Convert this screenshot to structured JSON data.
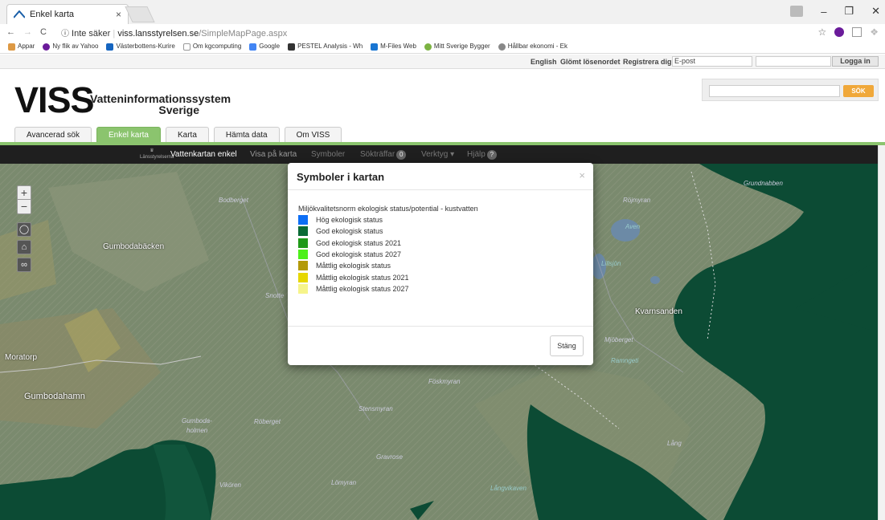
{
  "browser": {
    "tab_title": "Enkel karta",
    "tab_close": "×",
    "url_security": "Inte säker",
    "url_host": "viss.lansstyrelsen.se",
    "url_path": "/SimpleMapPage.aspx",
    "window_controls": [
      "–",
      "❐",
      "✕"
    ]
  },
  "bookmarks": [
    {
      "label": "Appar",
      "color": "#d94"
    },
    {
      "label": "Ny flik av Yahoo",
      "color": "#6a1b9a"
    },
    {
      "label": "Västerbottens-Kurire",
      "color": "#1565c0"
    },
    {
      "label": "Om kgcomputing",
      "color": "#aaa"
    },
    {
      "label": "Google",
      "color": "#4285f4"
    },
    {
      "label": "PESTEL Analysis - Wh",
      "color": "#333"
    },
    {
      "label": "M-Files Web",
      "color": "#1976d2"
    },
    {
      "label": "Mitt Sverige Bygger",
      "color": "#7cb342"
    },
    {
      "label": "Hållbar ekonomi - Ek",
      "color": "#888"
    }
  ],
  "topbar": {
    "english": "English",
    "forgot": "Glömt lösenordet",
    "register": "Registrera dig",
    "email_label": "E-post",
    "login": "Logga in"
  },
  "header": {
    "logo": "VISS",
    "subtitle_1": "Vatteninformationssystem",
    "subtitle_2": "Sverige",
    "search_button": "SÖK"
  },
  "nav_tabs": [
    {
      "label": "Avancerad sök",
      "active": false
    },
    {
      "label": "Enkel karta",
      "active": true
    },
    {
      "label": "Karta",
      "active": false
    },
    {
      "label": "Hämta data",
      "active": false
    },
    {
      "label": "Om VISS",
      "active": false
    }
  ],
  "map_toolbar": {
    "emblem": "Länsstyrelserna",
    "title": "Vattenkartan enkel",
    "items": [
      "Visa på karta",
      "Symboler",
      "Sökträffar",
      "Verktyg ▾",
      "Hjälp"
    ],
    "hits_badge": "0",
    "help_badge": "?"
  },
  "map_controls": {
    "zoom_in": "+",
    "zoom_out": "−"
  },
  "map_labels": [
    {
      "text": "Gumbodabäcken",
      "italic": false
    },
    {
      "text": "Moratorp",
      "italic": false
    },
    {
      "text": "Gumbodahamn",
      "italic": false
    },
    {
      "text": "Kvarnsanden",
      "italic": false
    },
    {
      "text": "Bodberget",
      "italic": true
    },
    {
      "text": "Snotte",
      "italic": true
    },
    {
      "text": "Röjmyran",
      "italic": true
    },
    {
      "text": "Aven",
      "italic": true
    },
    {
      "text": "Lillsjön",
      "italic": true
    },
    {
      "text": "Grundnabben",
      "italic": true
    },
    {
      "text": "Mjöberget",
      "italic": true
    },
    {
      "text": "Föskmyran",
      "italic": true
    },
    {
      "text": "Ramngeti",
      "italic": true
    },
    {
      "text": "Stensmyran",
      "italic": true
    },
    {
      "text": "Röberget",
      "italic": true
    },
    {
      "text": "Gumboda-",
      "italic": true
    },
    {
      "text": "holmen",
      "italic": true
    },
    {
      "text": "Gravrose",
      "italic": true
    },
    {
      "text": "Vikören",
      "italic": true
    },
    {
      "text": "Lömyran",
      "italic": true
    },
    {
      "text": "Långvikaven",
      "italic": true
    },
    {
      "text": "Lång",
      "italic": true
    }
  ],
  "modal": {
    "title": "Symboler i kartan",
    "close": "×",
    "legend_title": "Miljökvalitetsnorm ekologisk status/potential - kustvatten",
    "legend": [
      {
        "label": "Hög ekologisk status",
        "color": "#0d6ef5"
      },
      {
        "label": "God ekologisk status",
        "color": "#0b6b36"
      },
      {
        "label": "God ekologisk status 2021",
        "color": "#1f9a18"
      },
      {
        "label": "God ekologisk status 2027",
        "color": "#4df01a"
      },
      {
        "label": "Måttlig ekologisk status",
        "color": "#b39a0a"
      },
      {
        "label": "Måttlig ekologisk status 2021",
        "color": "#e6d700"
      },
      {
        "label": "Måttlig ekologisk status 2027",
        "color": "#f6f48a"
      }
    ],
    "close_button": "Stäng"
  }
}
